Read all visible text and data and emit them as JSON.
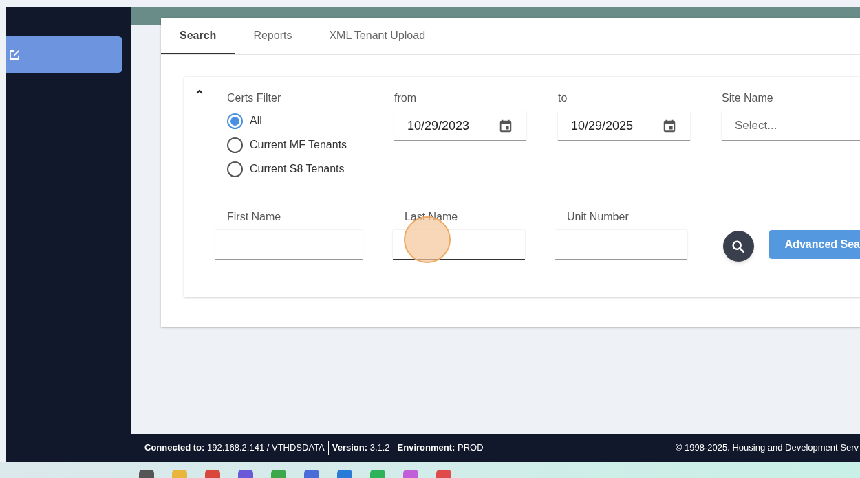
{
  "tabs": [
    {
      "label": "Search",
      "selected": true
    },
    {
      "label": "Reports",
      "selected": false
    },
    {
      "label": "XML Tenant Upload",
      "selected": false
    }
  ],
  "filter": {
    "expanded": true,
    "certs_label": "Certs Filter",
    "options": [
      {
        "label": "All",
        "selected": true
      },
      {
        "label": "Current MF Tenants",
        "selected": false
      },
      {
        "label": "Current S8 Tenants",
        "selected": false
      }
    ],
    "from": {
      "label": "from",
      "value": "10/29/2023"
    },
    "to": {
      "label": "to",
      "value": "10/29/2025"
    },
    "site": {
      "label": "Site Name",
      "placeholder": "Select..."
    },
    "fields": [
      {
        "label": "First Name"
      },
      {
        "label": "Last Name"
      },
      {
        "label": "Unit Number"
      }
    ],
    "advanced_button": "Advanced Sea"
  },
  "status_bar": {
    "items": [
      "**Connected to:** 192.168.2.141 / VTHDSDATA",
      "**Version:** 3.1.2",
      "**Environment:** PROD"
    ],
    "copyright": "© 1998-2025. Housing and Development Serv"
  }
}
